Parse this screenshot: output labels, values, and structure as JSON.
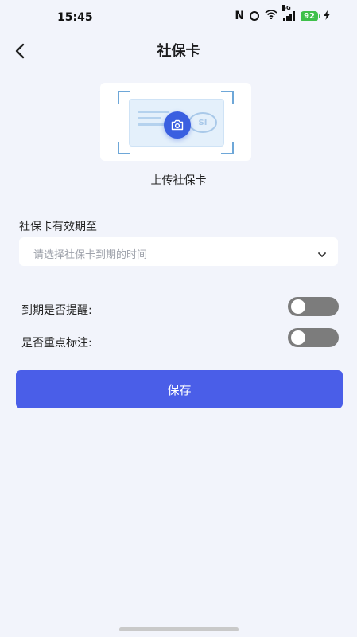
{
  "status_bar": {
    "time": "15:45",
    "nfc": "N",
    "network": "5G",
    "battery": "92",
    "icons": [
      "nfc-icon",
      "alarm-icon",
      "wifi-icon",
      "signal-icon",
      "battery-icon",
      "charging-icon"
    ]
  },
  "header": {
    "title": "社保卡",
    "back_icon": "chevron-left-icon"
  },
  "upload": {
    "label": "上传社保卡",
    "camera_icon": "camera-icon",
    "card_logo_text": "SI"
  },
  "validity": {
    "label": "社保卡有效期至",
    "placeholder": "请选择社保卡到期的时间",
    "dropdown_icon": "chevron-down-icon"
  },
  "settings": {
    "expiry_reminder": {
      "label": "到期是否提醒:",
      "enabled": false
    },
    "important_mark": {
      "label": "是否重点标注:",
      "enabled": false
    }
  },
  "actions": {
    "save_label": "保存"
  },
  "colors": {
    "background": "#f2f4fb",
    "accent": "#4a5ee8",
    "toggle_off": "#7c7c7c"
  }
}
